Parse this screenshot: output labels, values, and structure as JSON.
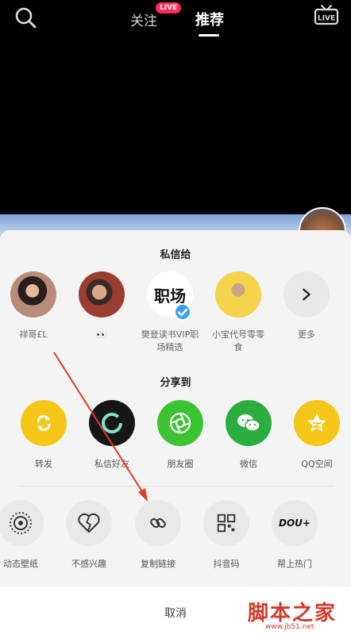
{
  "header": {
    "tab_follow": "关注",
    "live_badge": "LIVE",
    "tab_recommend": "推荐",
    "live_icon_label": "LIVE"
  },
  "dm": {
    "title": "私信给",
    "contacts": [
      {
        "name": "祥哥£L"
      },
      {
        "name": "👀"
      },
      {
        "name": "樊登读书VIP职场精选",
        "avatar_text": "职场"
      },
      {
        "name": "小宝代号零零食"
      },
      {
        "name": "更多"
      }
    ]
  },
  "share": {
    "title": "分享到",
    "items": [
      {
        "label": "转发",
        "color": "#f5c518",
        "icon": "repost-icon"
      },
      {
        "label": "私信好友",
        "color": "#161616",
        "icon": "message-ring-icon"
      },
      {
        "label": "朋友圈",
        "color": "#3bc431",
        "icon": "moments-icon"
      },
      {
        "label": "微信",
        "color": "#2aae3f",
        "icon": "wechat-icon"
      },
      {
        "label": "QQ空间",
        "color": "#f5c518",
        "icon": "qzone-icon"
      }
    ]
  },
  "actions": {
    "items": [
      {
        "label": "动态壁纸",
        "icon": "wallpaper-icon"
      },
      {
        "label": "不感兴趣",
        "icon": "broken-heart-icon"
      },
      {
        "label": "复制链接",
        "icon": "link-icon"
      },
      {
        "label": "抖音码",
        "icon": "qr-code-icon"
      },
      {
        "label": "帮上热门",
        "icon": "dou-plus-icon",
        "icon_text": "DOU+"
      }
    ]
  },
  "cancel_label": "取消",
  "watermark": {
    "brand": "脚本之家",
    "url": "www.jb51.net"
  }
}
